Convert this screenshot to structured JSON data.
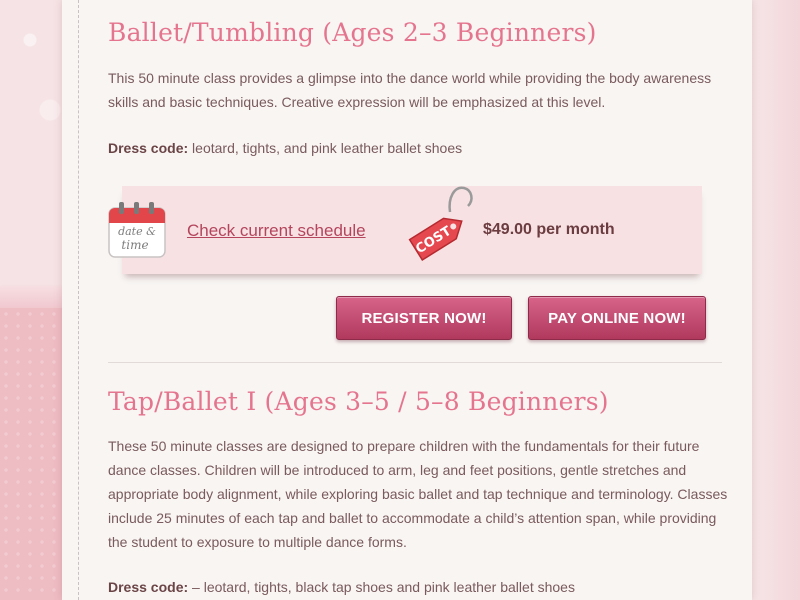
{
  "sections": [
    {
      "title": "Ballet/Tumbling (Ages 2–3 Beginners)",
      "description": "This 50 minute class provides a glimpse into the dance world while providing the body awareness skills and basic techniques. Creative expression will be emphasized at this level.",
      "dress_label": "Dress code:",
      "dress_value": " leotard, tights, and pink leather ballet shoes",
      "schedule_link": "Check current schedule",
      "calendar_icon_text": [
        "date &",
        "time"
      ],
      "tag_icon_text": "COST",
      "price": "$49.00 per month",
      "register_button": "REGISTER NOW!",
      "pay_button": "PAY ONLINE NOW!"
    },
    {
      "title": "Tap/Ballet I (Ages 3–5 / 5–8 Beginners)",
      "description": "These 50 minute classes are designed to prepare children with the fundamentals for their future dance classes. Children will be introduced to arm, leg and feet positions, gentle stretches and appropriate body alignment, while exploring basic ballet and tap technique and terminology. Classes include 25 minutes of each tap and ballet to accommodate a child’s attention span, while providing the student to exposure to multiple dance forms.",
      "dress_label": "Dress code:",
      "dress_value": " – leotard, tights, black tap shoes and pink leather ballet shoes"
    }
  ],
  "colors": {
    "title": "#e5758e",
    "body_text": "#7a5a5c",
    "link": "#b4455d",
    "button_top": "#d7648a",
    "button_bottom": "#b1395e",
    "info_box": "#f7e1e3"
  }
}
